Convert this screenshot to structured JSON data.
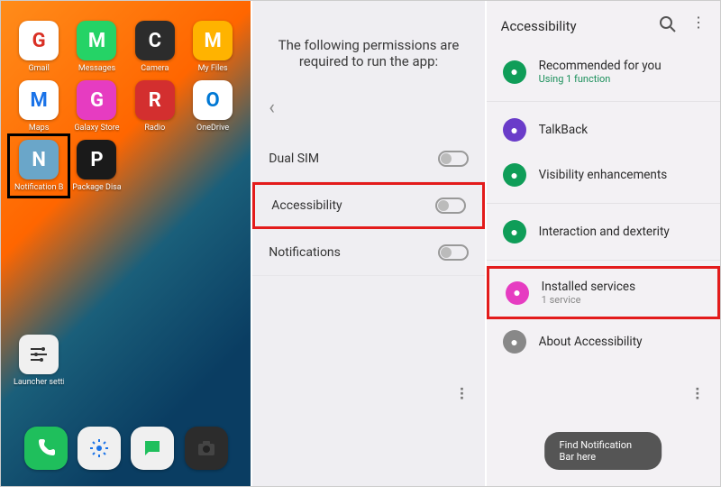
{
  "panel1": {
    "apps": [
      {
        "label": "Gmail",
        "bg": "#fff",
        "fg": "#d93025"
      },
      {
        "label": "Messages",
        "bg": "#25d366",
        "fg": "#fff"
      },
      {
        "label": "Camera",
        "bg": "#2c2c2c",
        "fg": "#fff"
      },
      {
        "label": "My Files",
        "bg": "#ffb300",
        "fg": "#fff"
      },
      {
        "label": "Maps",
        "bg": "#fff",
        "fg": "#1a73e8"
      },
      {
        "label": "Galaxy Store",
        "bg": "#e63cc1",
        "fg": "#fff"
      },
      {
        "label": "Radio",
        "bg": "#d32f2f",
        "fg": "#fff"
      },
      {
        "label": "OneDrive",
        "bg": "#fff",
        "fg": "#0078d4"
      },
      {
        "label": "Notification B",
        "bg": "#6aa6c9",
        "fg": "#fff",
        "highlighted": true
      },
      {
        "label": "Package Disa",
        "bg": "#1a1a1a",
        "fg": "#fff"
      }
    ],
    "launcher_label": "Launcher setti..",
    "dock": [
      {
        "name": "phone",
        "bg": "#1fbf5c"
      },
      {
        "name": "settings",
        "bg": "#f0f0f0"
      },
      {
        "name": "chat",
        "bg": "#f0f0f0"
      },
      {
        "name": "camera",
        "bg": "#2c2c2c"
      }
    ]
  },
  "panel2": {
    "heading": "The following permissions are required to run the app:",
    "items": [
      {
        "label": "Dual SIM"
      },
      {
        "label": "Accessibility",
        "highlighted": true
      },
      {
        "label": "Notifications"
      }
    ]
  },
  "panel3": {
    "title": "Accessibility",
    "rows": [
      {
        "icon_bg": "#0f9d58",
        "title": "Recommended for you",
        "sub": "Using 1 function",
        "sub_color": "green"
      },
      {
        "sep": true
      },
      {
        "icon_bg": "#6a3cc9",
        "title": "TalkBack"
      },
      {
        "icon_bg": "#0f9d58",
        "title": "Visibility enhancements"
      },
      {
        "sep": true
      },
      {
        "icon_bg": "#0f9d58",
        "title": "Interaction and dexterity"
      },
      {
        "sep": true
      },
      {
        "icon_bg": "#e63cc1",
        "title": "Installed services",
        "sub": "1 service",
        "sub_color": "grey",
        "highlighted": true
      },
      {
        "icon_bg": "#888",
        "title": "About Accessibility"
      }
    ],
    "toast": "Find Notification Bar here"
  }
}
